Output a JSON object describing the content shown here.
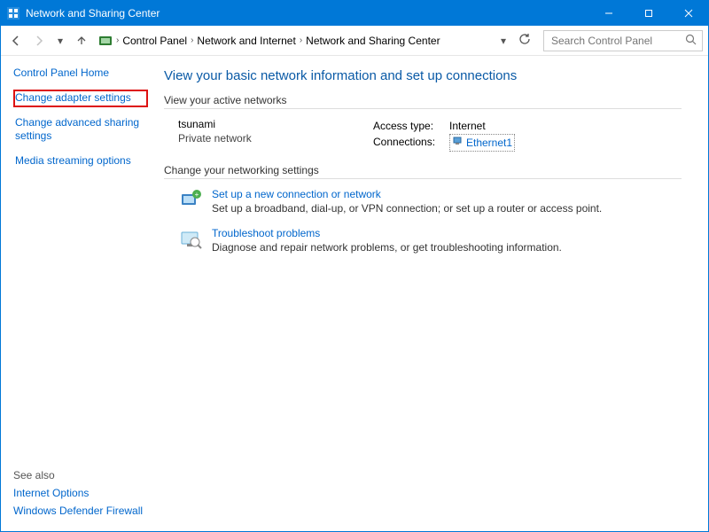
{
  "window": {
    "title": "Network and Sharing Center"
  },
  "breadcrumb": {
    "items": [
      "Control Panel",
      "Network and Internet",
      "Network and Sharing Center"
    ]
  },
  "search": {
    "placeholder": "Search Control Panel"
  },
  "sidebar": {
    "home": "Control Panel Home",
    "items": [
      "Change adapter settings",
      "Change advanced sharing settings",
      "Media streaming options"
    ],
    "seealso_header": "See also",
    "seealso": [
      "Internet Options",
      "Windows Defender Firewall"
    ]
  },
  "main": {
    "heading": "View your basic network information and set up connections",
    "active_legend": "View your active networks",
    "network": {
      "name": "tsunami",
      "type": "Private network",
      "access_label": "Access type:",
      "access_value": "Internet",
      "conn_label": "Connections:",
      "conn_value": "Ethernet1"
    },
    "change_legend": "Change your networking settings",
    "action1": {
      "title": "Set up a new connection or network",
      "desc": "Set up a broadband, dial-up, or VPN connection; or set up a router or access point."
    },
    "action2": {
      "title": "Troubleshoot problems",
      "desc": "Diagnose and repair network problems, or get troubleshooting information."
    }
  }
}
